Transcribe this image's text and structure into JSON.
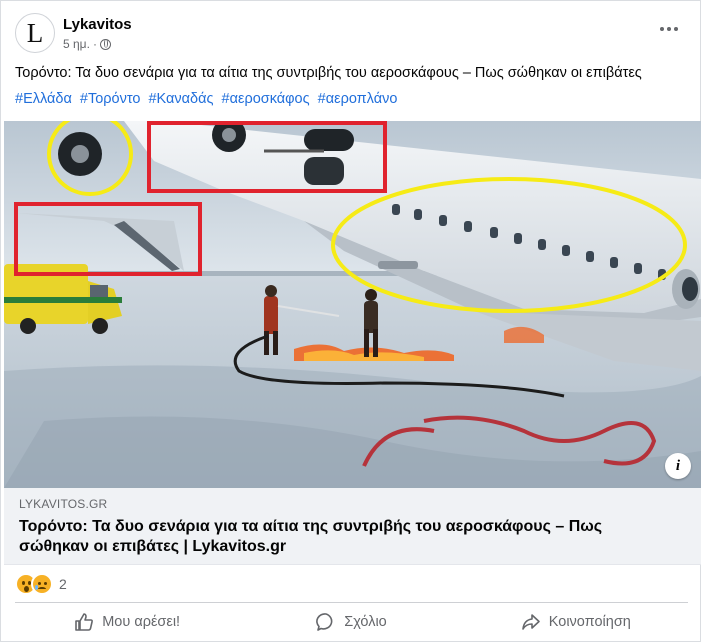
{
  "post": {
    "author": "Lykavitos",
    "avatar_letter": "L",
    "time": "5 ημ.",
    "separator": "·",
    "caption": "Τορόντο: Τα δυο σενάρια για τα αίτια της συντριβής του αεροσκάφους – Πως σώθηκαν οι επιβάτες",
    "hashtags": [
      "#Ελλάδα",
      "#Τορόντο",
      "#Καναδάς",
      "#αεροσκάφος",
      "#αεροπλάνο"
    ]
  },
  "link": {
    "domain": "LYKAVITOS.GR",
    "title": "Τορόντο: Τα δυο σενάρια για τα αίτια της συντριβής του αεροσκάφους – Πως σώθηκαν οι επιβάτες | Lykavitos.gr",
    "info_symbol": "i"
  },
  "reactions": {
    "types": [
      "wow",
      "sad"
    ],
    "count": "2"
  },
  "actions": {
    "like": "Μου αρέσει!",
    "comment": "Σχόλιο",
    "share": "Κοινοποίηση"
  },
  "colors": {
    "hashtag": "#216fdb",
    "annotation_red": "#e0232e",
    "annotation_yellow": "#f6eb16",
    "secondary_text": "#65676b"
  },
  "icons": {
    "privacy": "globe-icon",
    "more": "more-dots-icon",
    "like": "thumbs-up-icon",
    "comment": "comment-bubble-icon",
    "share": "share-arrow-icon"
  }
}
